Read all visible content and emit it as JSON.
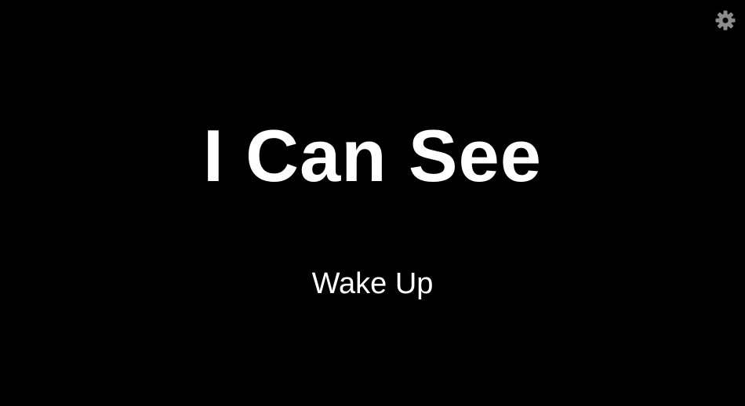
{
  "game": {
    "title": "I Can See",
    "menu": {
      "wake_up_label": "Wake Up"
    }
  },
  "icons": {
    "settings": "gear-icon"
  },
  "colors": {
    "background": "#000000",
    "text": "#ffffff",
    "icon": "#8c8c8c"
  }
}
